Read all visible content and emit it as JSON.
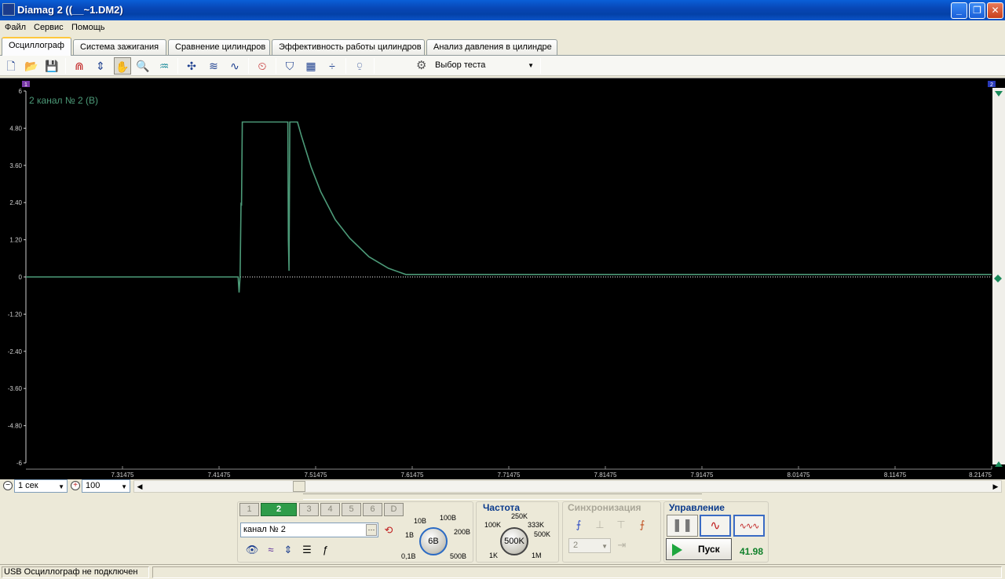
{
  "window": {
    "title": "Diamag 2 ((__~1.DM2)",
    "controls": {
      "minimize": "_",
      "maximize": "❐",
      "close": "✕"
    }
  },
  "menu": [
    "Файл",
    "Сервис",
    "Помощь"
  ],
  "tabs": [
    {
      "label": "Осциллограф",
      "active": true
    },
    {
      "label": "Система зажигания",
      "active": false
    },
    {
      "label": "Сравнение цилиндров",
      "active": false
    },
    {
      "label": "Эффективность работы цилиндров",
      "active": false
    },
    {
      "label": "Анализ давления в цилиндре",
      "active": false
    }
  ],
  "toolbar": {
    "icons": [
      "new-icon",
      "open-icon",
      "save-icon",
      "cursor-a-icon",
      "cursor-b-icon",
      "hand-icon",
      "zoom-icon",
      "signal-filter-icon",
      "channel-separate-icon",
      "channel-overlay-icon",
      "channel-math-icon",
      "auto-trigger-icon",
      "filter-icon",
      "grid-icon",
      "split-icon",
      "auto-icon"
    ],
    "test_select_label": "Выбор теста"
  },
  "scope": {
    "channel_label": "2 канал № 2 (В)",
    "marker_left": "1",
    "marker_right": "2",
    "colors": {
      "background": "#000000",
      "trace": "#4c9a78",
      "axis": "#cccccc",
      "zero_line": "#ffffff"
    }
  },
  "chart_data": {
    "type": "line",
    "title": "2 канал № 2 (В)",
    "xlabel": "",
    "ylabel": "",
    "ylim": [
      -6,
      6
    ],
    "xlim": [
      7.21475,
      8.21475
    ],
    "y_ticks": [
      "6",
      "4.80",
      "3.60",
      "2.40",
      "1.20",
      "0",
      "-1.20",
      "-2.40",
      "-3.60",
      "-4.80",
      "-6"
    ],
    "x_ticks": [
      "7.31475",
      "7.41475",
      "7.51475",
      "7.61475",
      "7.71475",
      "7.81475",
      "7.91475",
      "8.01475",
      "8.11475",
      "8.21475"
    ],
    "series": [
      {
        "x": [
          7.21475,
          7.4345,
          7.4355,
          7.4365,
          7.4375,
          7.438,
          7.4388,
          7.4395,
          7.486,
          7.4865,
          7.4872,
          7.488,
          7.4885,
          7.489,
          7.496,
          7.5,
          7.51,
          7.52,
          7.535,
          7.55,
          7.57,
          7.59,
          7.608,
          7.65,
          7.75,
          7.85,
          7.95,
          8.05,
          8.15,
          8.21475
        ],
        "values": [
          0,
          0,
          -0.5,
          0,
          2.4,
          2.3,
          5.0,
          5.0,
          5.0,
          1.2,
          0.2,
          5.0,
          5.0,
          5.0,
          5.0,
          4.55,
          3.55,
          2.75,
          1.85,
          1.25,
          0.65,
          0.28,
          0.08,
          0.08,
          0.08,
          0.08,
          0.08,
          0.08,
          0.08,
          0.08
        ]
      }
    ]
  },
  "timebase": {
    "value": "1 сек",
    "zoom": "100"
  },
  "channels": {
    "buttons": [
      "1",
      "2",
      "3",
      "4",
      "5",
      "6",
      "D"
    ],
    "active": "2",
    "name_field": "канал № 2",
    "name_dots": "···"
  },
  "voltage_knob": {
    "current": "6В",
    "labels": [
      "10В",
      "100В",
      "1В",
      "200В",
      "0,1В",
      "500В"
    ]
  },
  "frequency": {
    "title": "Частота",
    "current": "500K",
    "labels": [
      "250K",
      "100K",
      "333K",
      "500K",
      "1K",
      "1M"
    ]
  },
  "sync": {
    "title": "Синхронизация",
    "channel": "2"
  },
  "control": {
    "title": "Управление",
    "run_label": "Пуск",
    "fps": "41.98"
  },
  "status": {
    "text": "USB Осциллограф не подключен"
  }
}
